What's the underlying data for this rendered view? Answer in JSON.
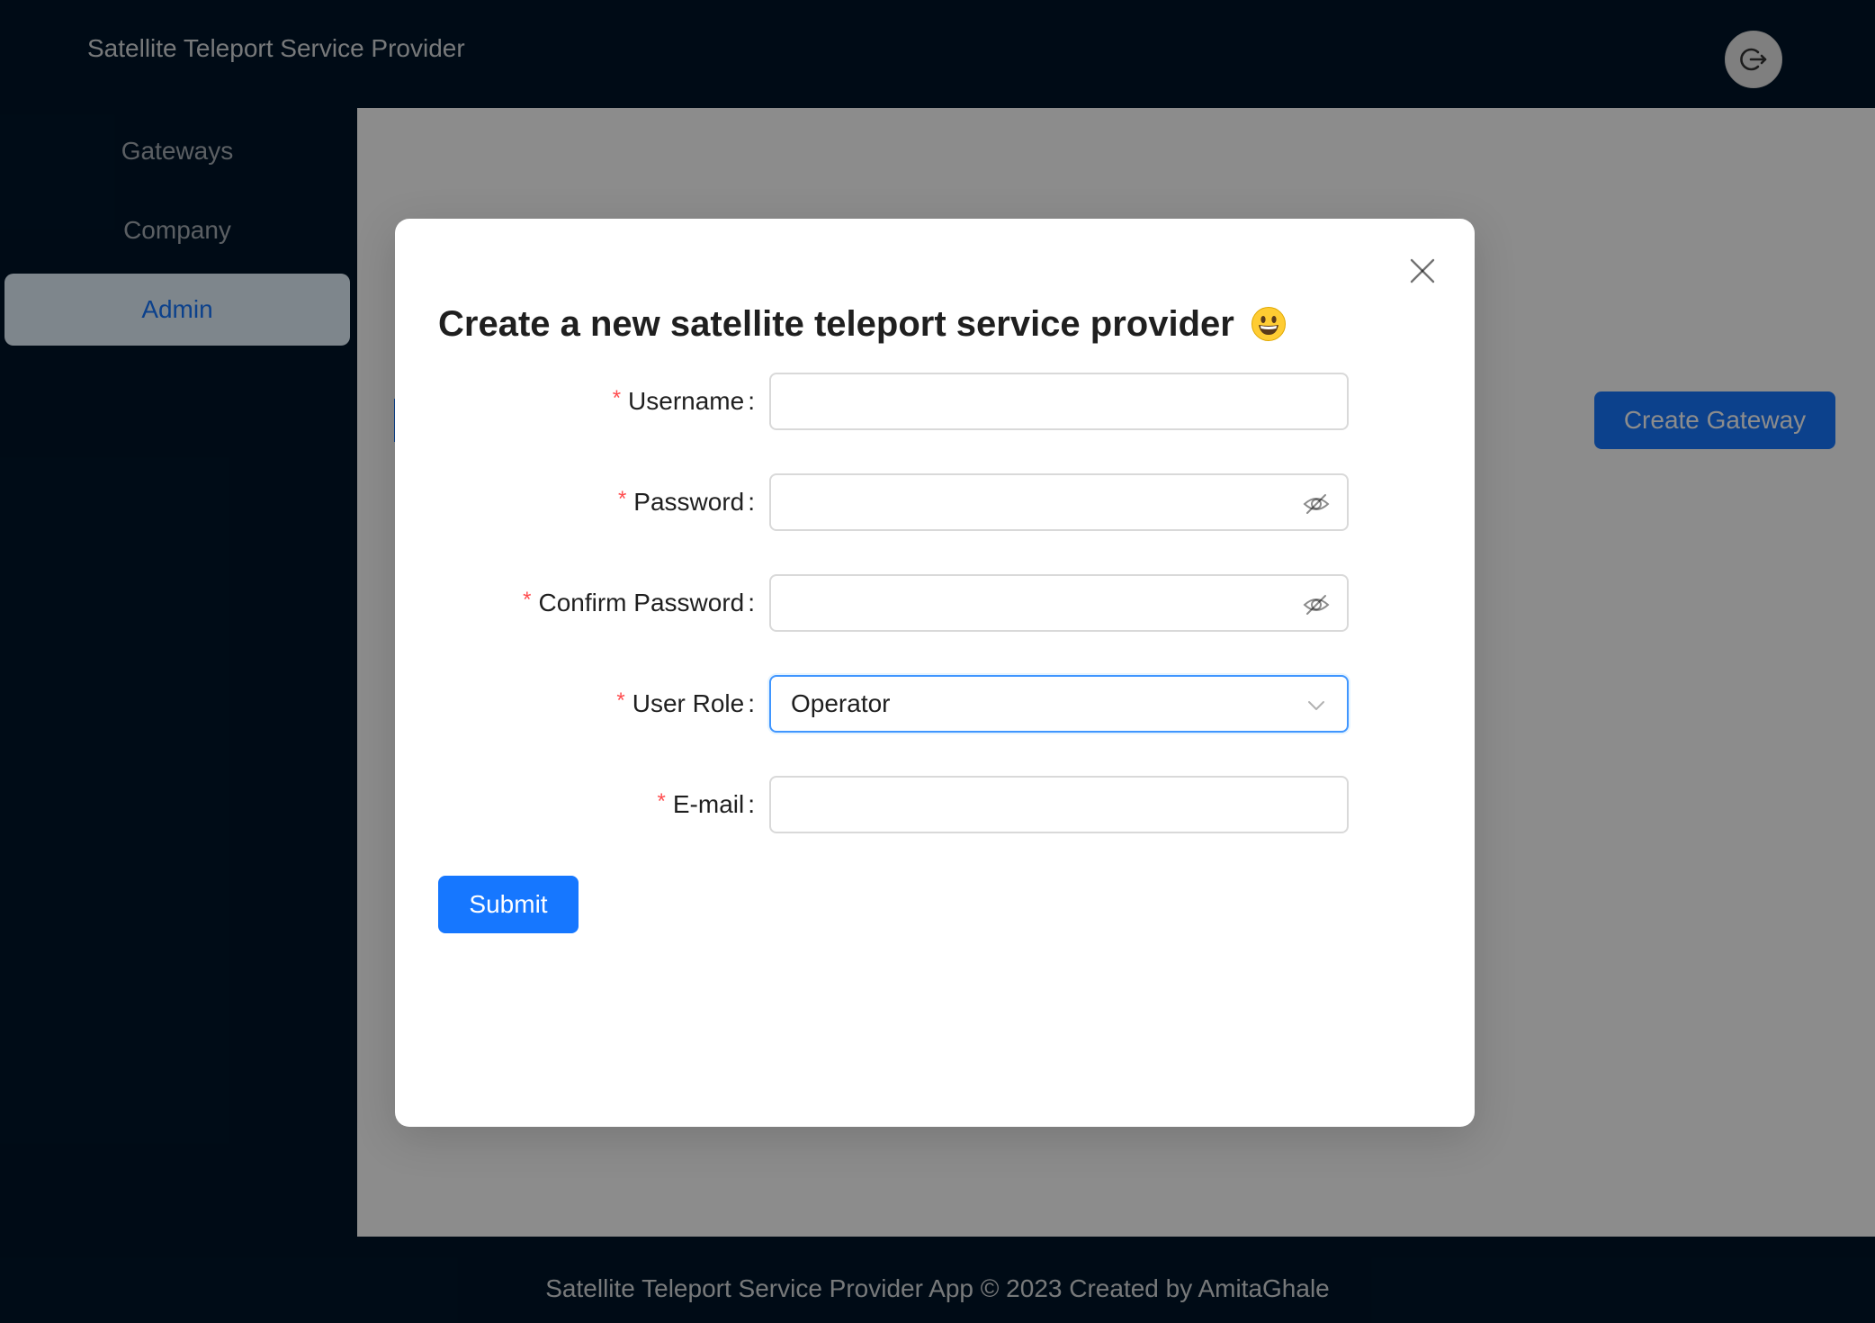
{
  "header": {
    "title": "Satellite Teleport Service Provider",
    "logout_icon": "logout-icon"
  },
  "sidebar": {
    "items": [
      {
        "label": "Gateways",
        "active": false
      },
      {
        "label": "Company",
        "active": false
      },
      {
        "label": "Admin",
        "active": true
      }
    ]
  },
  "main": {
    "create_gateway_label": "Create Gateway"
  },
  "footer": {
    "text": "Satellite Teleport Service Provider App © 2023 Created by AmitaGhale"
  },
  "modal": {
    "title": "Create a new satellite teleport service provider",
    "title_emoji": "grinning-face-emoji",
    "close_icon": "close-icon",
    "fields": {
      "username": {
        "label": "Username",
        "value": "",
        "required": true
      },
      "password": {
        "label": "Password",
        "value": "",
        "required": true,
        "suffix_icon": "eye-invisible-icon"
      },
      "confirm_password": {
        "label": "Confirm Password",
        "value": "",
        "required": true,
        "suffix_icon": "eye-invisible-icon"
      },
      "user_role": {
        "label": "User Role",
        "value": "Operator",
        "required": true,
        "suffix_icon": "chevron-down-icon"
      },
      "email": {
        "label": "E-mail",
        "value": "",
        "required": true
      }
    },
    "submit_label": "Submit",
    "required_mark": "*",
    "colon": ":"
  },
  "colors": {
    "primary": "#1677ff",
    "header_bg": "#001529",
    "required": "#ff4d4f"
  }
}
